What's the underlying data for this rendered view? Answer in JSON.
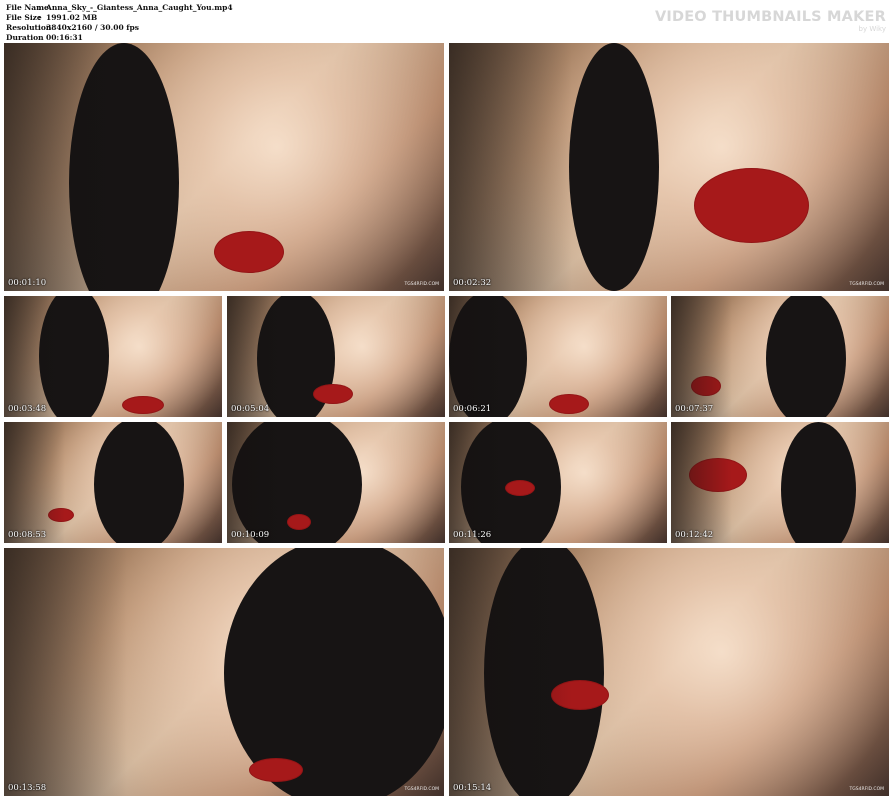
{
  "file_info": [
    {
      "key": "File Name",
      "value": "Anna_Sky_-_Giantess_Anna_Caught_You.mp4"
    },
    {
      "key": "File Size",
      "value": "1991.02 MB"
    },
    {
      "key": "Resolution",
      "value": "3840x2160 / 30.00 fps"
    },
    {
      "key": "Duration",
      "value": "00:16:31"
    }
  ],
  "branding": {
    "title": "VIDEO THUMBNAILS MAKER",
    "subtitle": "by Wiky"
  },
  "thumbnails": [
    {
      "time": "00:01:10",
      "watermark": "TGS4RFID.COM"
    },
    {
      "time": "00:02:32",
      "watermark": "TGS4RFID.COM"
    },
    {
      "time": "00:03:48",
      "watermark": ""
    },
    {
      "time": "00:05:04",
      "watermark": ""
    },
    {
      "time": "00:06:21",
      "watermark": ""
    },
    {
      "time": "00:07:37",
      "watermark": ""
    },
    {
      "time": "00:08:53",
      "watermark": ""
    },
    {
      "time": "00:10:09",
      "watermark": ""
    },
    {
      "time": "00:11:26",
      "watermark": ""
    },
    {
      "time": "00:12:42",
      "watermark": ""
    },
    {
      "time": "00:13:58",
      "watermark": "TGS4RFID.COM"
    },
    {
      "time": "00:15:14",
      "watermark": "TGS4RFID.COM"
    }
  ]
}
